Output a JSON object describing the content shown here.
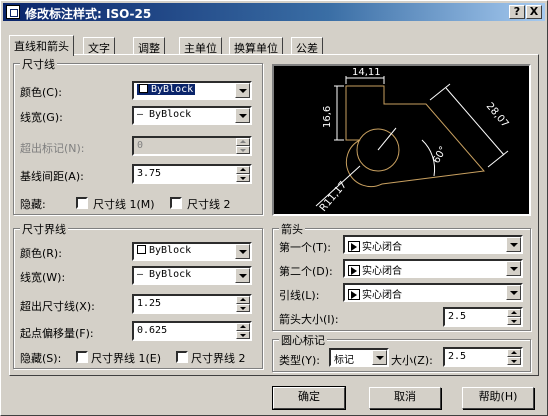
{
  "window": {
    "title": "修改标注样式: ISO-25",
    "help": "?",
    "close": "X"
  },
  "tabs": [
    "直线和箭头",
    "文字",
    "调整",
    "主单位",
    "换算单位",
    "公差"
  ],
  "dim_lines": {
    "legend": "尺寸线",
    "color_label": "颜色(C):",
    "color_value": "ByBlock",
    "width_label": "线宽(G):",
    "width_value": "— ByBlock",
    "extend_label": "超出标记(N):",
    "extend_value": "0",
    "baseline_label": "基线间距(A):",
    "baseline_value": "3.75",
    "suppress_label": "隐藏:",
    "suppress_1": "尺寸线 1(M)",
    "suppress_2": "尺寸线 2"
  },
  "ext_lines": {
    "legend": "尺寸界线",
    "color_label": "颜色(R):",
    "color_value": "ByBlock",
    "width_label": "线宽(W):",
    "width_value": "— ByBlock",
    "beyond_label": "超出尺寸线(X):",
    "beyond_value": "1.25",
    "offset_label": "起点偏移量(F):",
    "offset_value": "0.625",
    "suppress_label": "隐藏(S):",
    "suppress_1": "尺寸界线 1(E)",
    "suppress_2": "尺寸界线 2"
  },
  "preview": {
    "dim_top": "14,11",
    "dim_left": "16,6",
    "dim_right": "28,07",
    "angle": "60°",
    "radius": "R11,17"
  },
  "arrows": {
    "legend": "箭头",
    "first_label": "第一个(T):",
    "first_value": "实心闭合",
    "second_label": "第二个(D):",
    "second_value": "实心闭合",
    "leader_label": "引线(L):",
    "leader_value": "实心闭合",
    "size_label": "箭头大小(I):",
    "size_value": "2.5"
  },
  "center": {
    "legend": "圆心标记",
    "type_label": "类型(Y):",
    "type_value": "标记",
    "size_label": "大小(Z):",
    "size_value": "2.5"
  },
  "buttons": {
    "ok": "确定",
    "cancel": "取消",
    "help": "帮助(H)"
  },
  "colors": {
    "accent": "#0a246a",
    "face": "#d4d0c8",
    "preview_line": "#c8a060"
  }
}
